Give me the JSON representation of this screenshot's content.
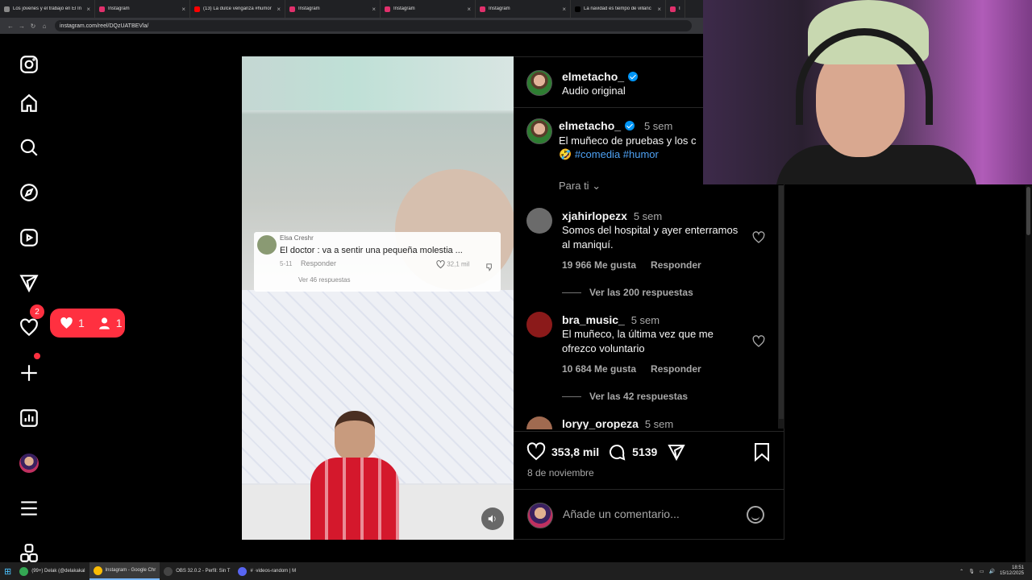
{
  "browser": {
    "tabs": [
      {
        "title": "Los jóvenes y el trabajo en El In",
        "color": "#888888"
      },
      {
        "title": "Instagram",
        "color": "#e1306c"
      },
      {
        "title": "(13) La dulce venganza #humor",
        "color": "#ff0000"
      },
      {
        "title": "Instagram",
        "color": "#e1306c"
      },
      {
        "title": "Instagram",
        "color": "#e1306c"
      },
      {
        "title": "Instagram",
        "color": "#e1306c"
      },
      {
        "title": "La navidad es tiempo de villanc",
        "color": "#000000"
      },
      {
        "title": "Ir",
        "color": "#e1306c"
      }
    ],
    "url": "instagram.com/reel/DQzUATBEVla/"
  },
  "sidebar": {
    "icons": [
      "instagram-icon",
      "home-icon",
      "search-icon",
      "explore-icon",
      "reels-icon",
      "messages-icon",
      "notifications-icon",
      "create-icon",
      "dashboard-icon",
      "profile-avatar",
      "menu-icon",
      "more-icon"
    ],
    "messages_badge": "2",
    "notif_likes": "1",
    "notif_follows": "1"
  },
  "overlay_comment": {
    "username": "Elsa Creshr",
    "text": "El doctor : va a sentir una pequeña molestia ...",
    "time": "5-11",
    "reply": "Responder",
    "likes": "32,1 mil",
    "view_replies": "Ver 46 respuestas"
  },
  "post": {
    "author": "elmetacho_",
    "audio": "Audio original",
    "age": "5 sem",
    "caption": "El muñeco de pruebas y los c",
    "hashtags": "#comedia #humor",
    "caption_emoji": "🤣",
    "sort_label": "Para ti",
    "likes": "353,8 mil",
    "comments_count": "5139",
    "date": "8 de noviembre",
    "comment_placeholder": "Añade un comentario..."
  },
  "comments": [
    {
      "user": "xjahirlopezx",
      "age": "5 sem",
      "text": "Somos del hospital y ayer enterramos al maniquí.",
      "likes": "19 966 Me gusta",
      "reply": "Responder",
      "replies": "Ver las 200 respuestas",
      "avatar": "#6b6b6b"
    },
    {
      "user": "bra_music_",
      "age": "5 sem",
      "text": "El muñeco, la última vez que me ofrezco voluntario",
      "likes": "10 684 Me gusta",
      "reply": "Responder",
      "replies": "Ver las 42 respuestas",
      "avatar": "#8b1a1a"
    },
    {
      "user": "loryy_oropeza",
      "age": "5 sem",
      "avatar": "#a06a50"
    }
  ],
  "taskbar": {
    "items": [
      {
        "label": "(99+) Delak (@delakakal",
        "color": "#34a853",
        "active": false
      },
      {
        "label": "Instagram - Google Chr",
        "color": "#fbbc05",
        "active": true
      },
      {
        "label": "OBS 32.0.2 - Perfil: Sin T",
        "color": "#444444",
        "active": false
      },
      {
        "label": "# ·videos-random | M",
        "color": "#5865f2",
        "active": false
      }
    ],
    "time": "18:51",
    "date": "15/12/2025"
  }
}
